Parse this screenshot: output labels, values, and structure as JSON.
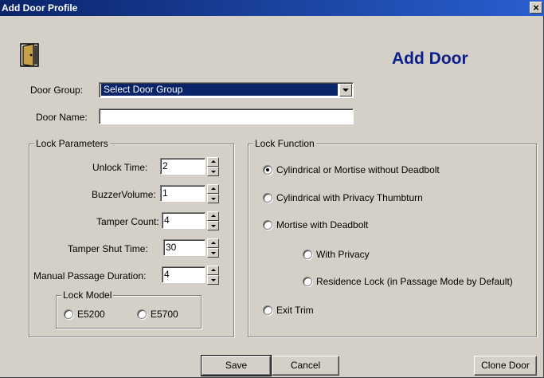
{
  "window": {
    "title": "Add Door Profile",
    "close_glyph": "×",
    "heading": "Add Door",
    "heading_color": "#0a1e8c",
    "titlebar_color": "#0a246a"
  },
  "door_group": {
    "label": "Door Group:",
    "selected": "Select Door Group"
  },
  "door_name": {
    "label": "Door Name:",
    "value": ""
  },
  "lock_parameters": {
    "title": "Lock Parameters",
    "fields": [
      {
        "label": "Unlock Time:",
        "value": "2"
      },
      {
        "label": "BuzzerVolume:",
        "value": "1"
      },
      {
        "label": "Tamper Count:",
        "value": "4"
      },
      {
        "label": "Tamper Shut Time:",
        "value": "30"
      },
      {
        "label": "Manual Passage Duration:",
        "value": "4"
      }
    ],
    "lock_model": {
      "title": "Lock Model",
      "options": [
        {
          "label": "E5200",
          "checked": false
        },
        {
          "label": "E5700",
          "checked": false
        }
      ]
    }
  },
  "lock_function": {
    "title": "Lock Function",
    "options": [
      {
        "label": "Cylindrical or Mortise without Deadbolt",
        "checked": true
      },
      {
        "label": "Cylindrical with Privacy Thumbturn",
        "checked": false
      },
      {
        "label": "Mortise with Deadbolt",
        "checked": false
      },
      {
        "label": "With Privacy",
        "checked": false
      },
      {
        "label": "Residence Lock (in Passage Mode by Default)",
        "checked": false
      },
      {
        "label": "Exit Trim",
        "checked": false
      }
    ]
  },
  "buttons": {
    "save": "Save",
    "cancel": "Cancel",
    "clone": "Clone Door"
  },
  "icons": {
    "logo": "door-icon",
    "close": "close-icon",
    "dropdown": "chevron-down-icon"
  }
}
